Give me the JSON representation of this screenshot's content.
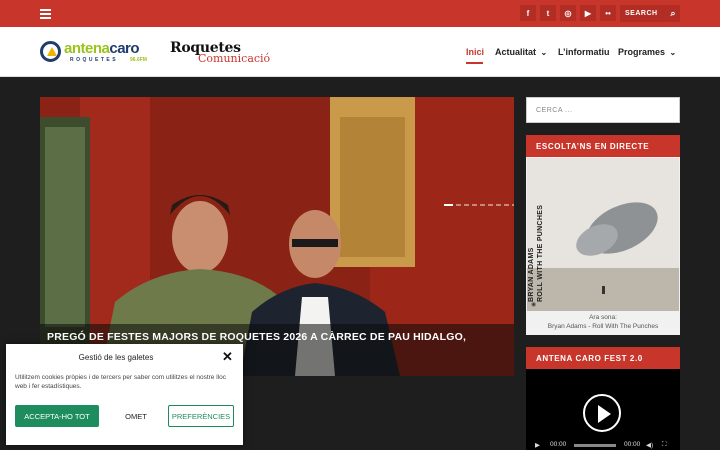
{
  "topbar": {
    "menu_icon": "hamburger-icon",
    "social_icons": [
      "facebook-icon",
      "twitter-icon",
      "instagram-icon",
      "youtube-icon",
      "flickr-icon"
    ],
    "search_label": "SEARCH",
    "background": "#c8362b"
  },
  "header": {
    "logo_antena": {
      "part1": "antena",
      "part2": "caro",
      "subtitle": "ROQUETES",
      "freq": "96.6FM"
    },
    "logo_roquetes": {
      "line1": "Roquetes",
      "line2": "Comunicació"
    },
    "nav": [
      {
        "label": "Inici",
        "active": true,
        "dropdown": false
      },
      {
        "label": "Actualitat",
        "active": false,
        "dropdown": true
      },
      {
        "label": "L’informatiu",
        "active": false,
        "dropdown": false
      },
      {
        "label": "Programes",
        "active": false,
        "dropdown": true
      }
    ],
    "dropdown_glyph": "⌄"
  },
  "hero": {
    "title": "PREGÓ DE FESTES MAJORS DE ROQUETES 2026 A CÀRREC DE PAU HIDALGO, ESPORTISTA",
    "slide_count": 12,
    "active_slide": 1
  },
  "sidebar": {
    "search_placeholder": "CERCA ...",
    "live_widget": {
      "title": "ESCOLTA’NS EN DIRECTE",
      "album_text_1": "BRYAN ADAMS",
      "album_text_2": "ROLL WITH THE PUNCHES",
      "now_label": "Ara sona:",
      "now_track": "Bryan Adams - Roll With The Punches"
    },
    "fest_widget": {
      "title": "ANTENA CARO FEST 2.0",
      "time_current": "00:00",
      "time_total": "00:00"
    }
  },
  "cookie": {
    "title": "Gestió de les galetes",
    "text": "Utilitzem cookies pròpies i de tercers per saber com utilitzes el nostre lloc web i fer estadístiques.",
    "accept": "ACCEPTA-HO TOT",
    "deny": "OMET",
    "prefs": "PREFERÈNCIES",
    "accent": "#1e8d5e"
  }
}
